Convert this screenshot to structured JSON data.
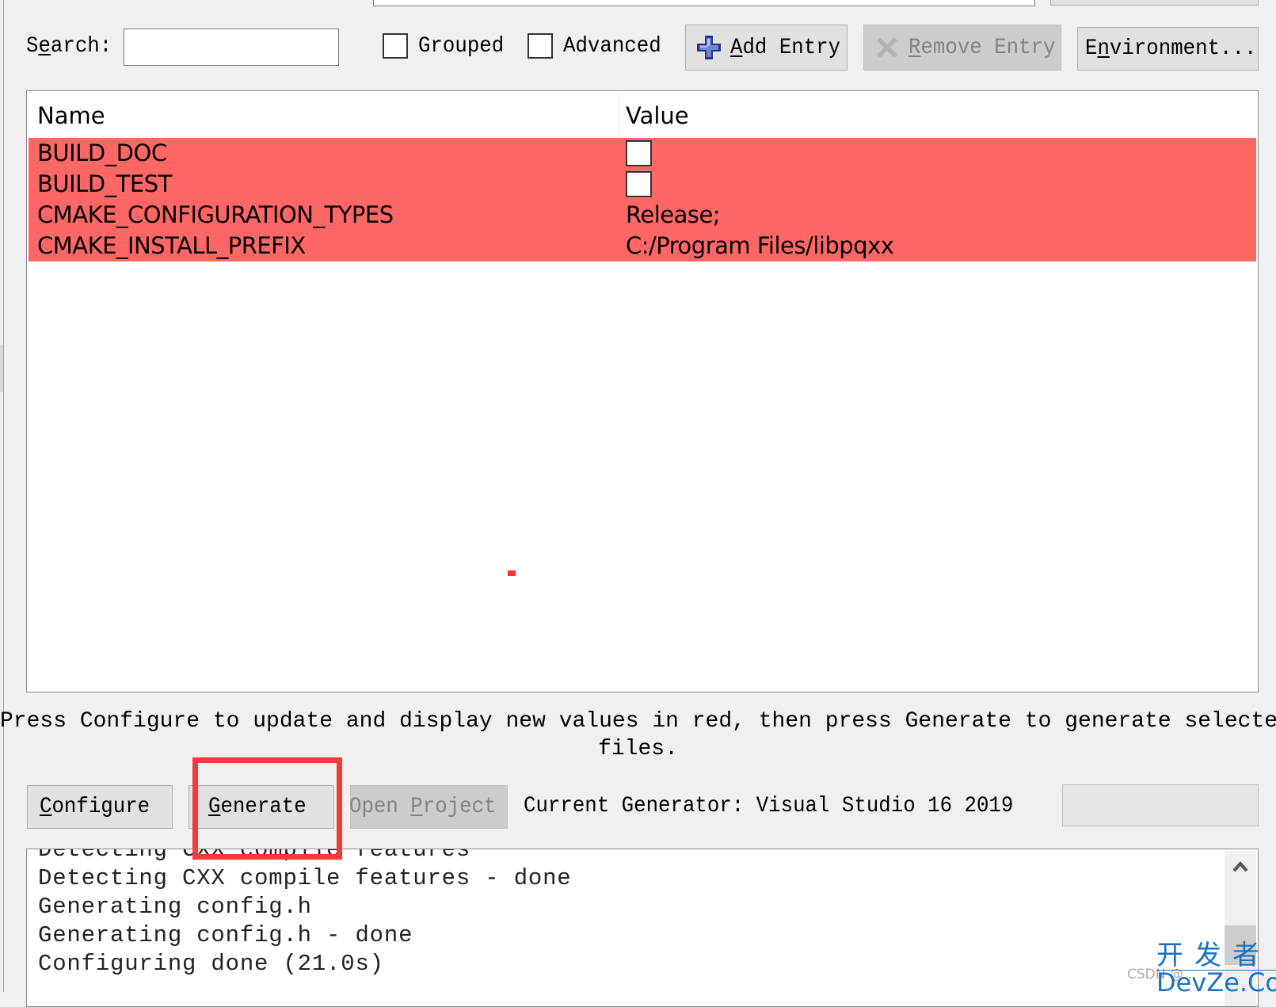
{
  "toolbar": {
    "search_label": "Search:",
    "search_value": "",
    "grouped_label": "Grouped",
    "grouped_checked": false,
    "advanced_label": "Advanced",
    "advanced_checked": false,
    "add_entry_label": "Add Entry",
    "remove_entry_label": "Remove Entry",
    "environment_label": "Environment...",
    "icons": {
      "add": "plus-icon",
      "remove": "x-remove-icon"
    }
  },
  "table": {
    "columns": [
      "Name",
      "Value"
    ],
    "row_color": "#ff6666",
    "rows": [
      {
        "name": "BUILD_DOC",
        "type": "bool",
        "value": false
      },
      {
        "name": "BUILD_TEST",
        "type": "bool",
        "value": false
      },
      {
        "name": "CMAKE_CONFIGURATION_TYPES",
        "type": "string",
        "value": "Release;"
      },
      {
        "name": "CMAKE_INSTALL_PREFIX",
        "type": "string",
        "value": "C:/Program Files/libpqxx"
      }
    ]
  },
  "status": {
    "line1": "Press Configure to update and display new values in red, then press Generate to generate selected build",
    "line2": "files."
  },
  "actions": {
    "configure_label": "Configure",
    "generate_label": "Generate",
    "open_project_label": "Open Project",
    "current_generator": "Current Generator: Visual Studio 16 2019",
    "highlight_color": "#f33b3b"
  },
  "output": {
    "lines": [
      "Detecting CXX compile features",
      "Detecting CXX compile features - done",
      "Generating config.h",
      "Generating config.h - done",
      "Configuring done (21.0s)"
    ]
  },
  "watermark": {
    "cn": "开发者",
    "en": "DevZe.CoM",
    "csdn": "CSDN @..."
  }
}
